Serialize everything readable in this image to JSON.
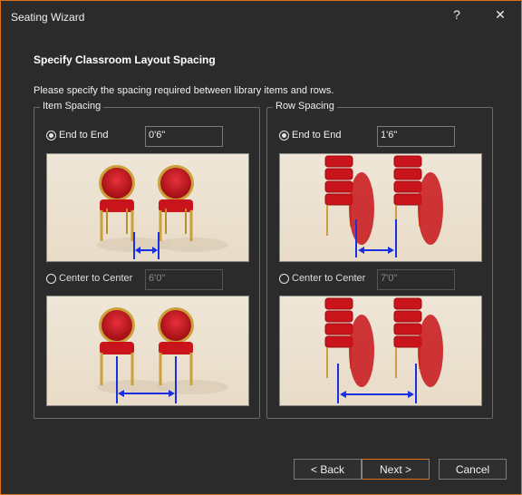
{
  "window": {
    "title": "Seating Wizard",
    "help_glyph": "?",
    "close_glyph": "✕"
  },
  "page": {
    "heading": "Specify Classroom Layout Spacing",
    "description": "Please specify the spacing required between library items and rows."
  },
  "item_spacing": {
    "legend": "Item Spacing",
    "end_to_end": {
      "label": "End to End",
      "value": "0'6\"",
      "selected": true
    },
    "center_to_center": {
      "label": "Center to Center",
      "value": "6'0\"",
      "selected": false
    }
  },
  "row_spacing": {
    "legend": "Row Spacing",
    "end_to_end": {
      "label": "End to End",
      "value": "1'6\"",
      "selected": true
    },
    "center_to_center": {
      "label": "Center to Center",
      "value": "7'0\"",
      "selected": false
    }
  },
  "buttons": {
    "back": "< Back",
    "next": "Next >",
    "cancel": "Cancel"
  },
  "colors": {
    "accent": "#d9731d",
    "dimension_line": "#1a2fe0",
    "chair_red": "#c8141a",
    "chair_frame": "#c9a03a"
  }
}
